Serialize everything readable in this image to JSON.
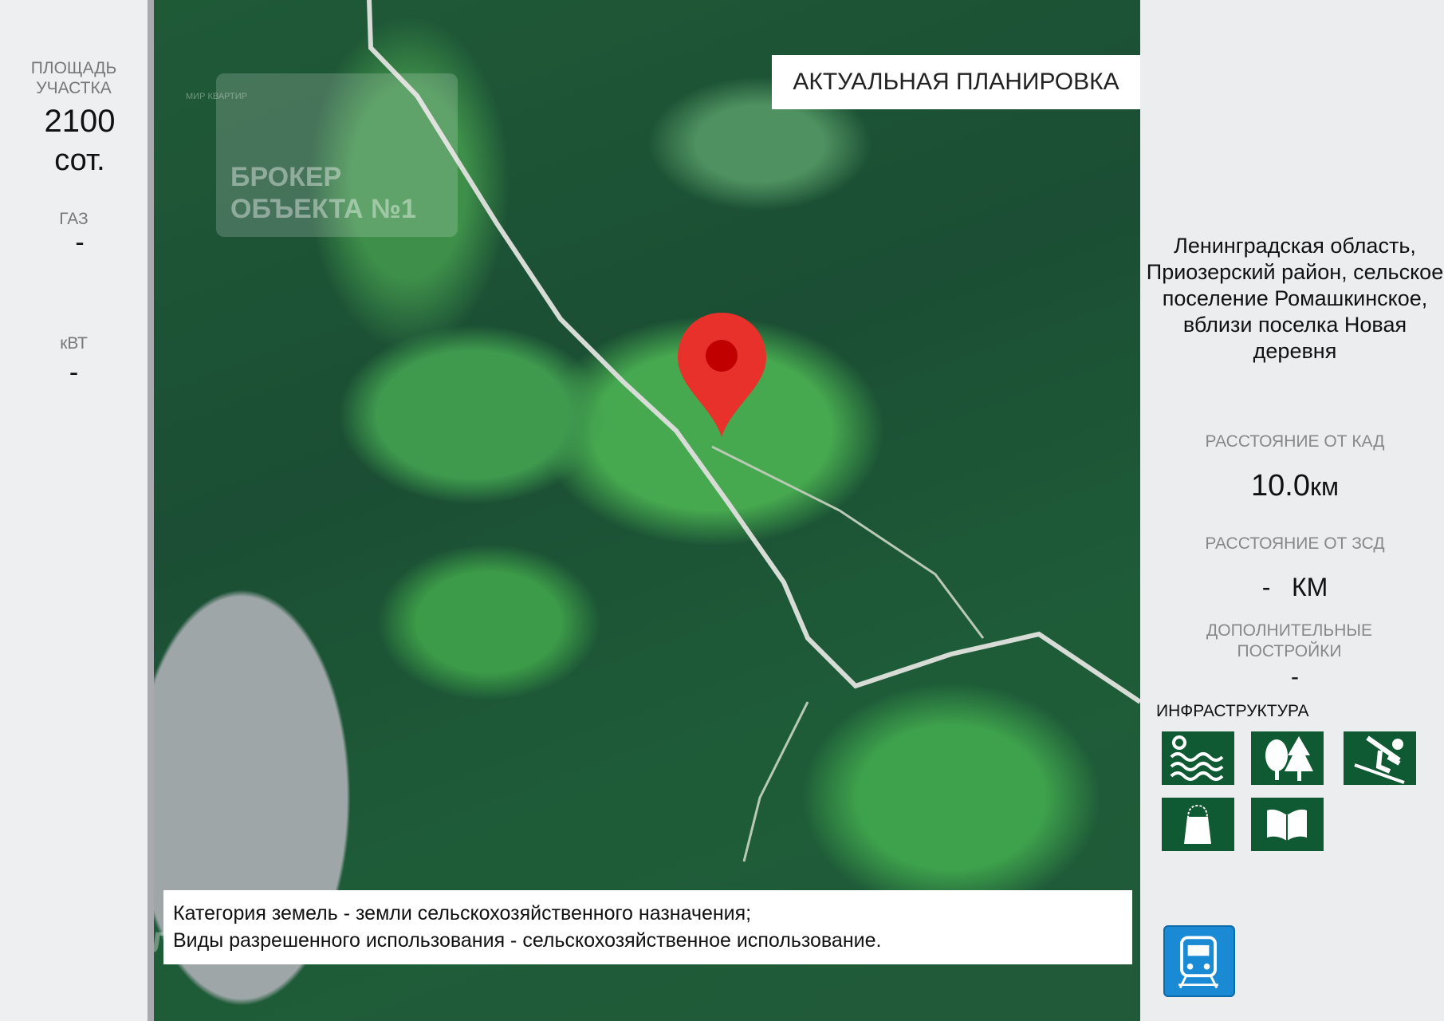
{
  "left_panel": {
    "area_label": "ПЛОЩАДЬ УЧАСТКА",
    "area_value": "2100",
    "area_unit": "сот.",
    "gas_label": "ГАЗ",
    "gas_value": "-",
    "power_label": "кВТ",
    "power_value": "-"
  },
  "map": {
    "title": "АКТУАЛЬНАЯ ПЛАНИРОВКА",
    "watermark": "БРОКЕР ОБЪЕКТА №1",
    "watermark_logo": "МИР КВАРТИР",
    "domclick": "ДомКлик",
    "caption_line1": "Категория земель - земли сельскохозяйственного назначения;",
    "caption_line2": "Виды разрешенного использования - сельскохозяйственное использование.",
    "pin_color": "#e8312b"
  },
  "right_panel": {
    "address": "Ленинградская область, Приозерский район, сельское поселение Ромашкинское, вблизи поселка Новая деревня",
    "kad_label": "РАССТОЯНИЕ ОТ КАД",
    "kad_value": "10.0",
    "kad_unit": "км",
    "zsd_label": "РАССТОЯНИЕ ОТ ЗСД",
    "zsd_value": "-",
    "zsd_unit": "КМ",
    "extra_label": "ДОПОЛНИТЕЛЬНЫЕ ПОСТРОЙКИ",
    "extra_value": "-",
    "infra_label": "ИНФРАСТРУКТУРА",
    "infra_icons": [
      "water-icon",
      "forest-icon",
      "ski-icon",
      "shopping-icon",
      "book-icon",
      "train-icon"
    ],
    "icon_color": "#0f5a33",
    "train_color": "#1a8ad4"
  }
}
